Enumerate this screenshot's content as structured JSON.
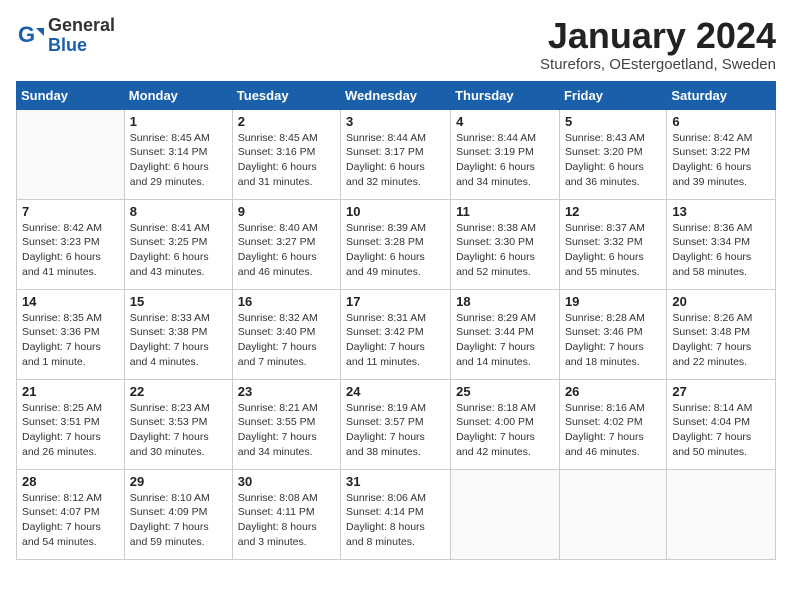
{
  "header": {
    "logo_general": "General",
    "logo_blue": "Blue",
    "title": "January 2024",
    "subtitle": "Sturefors, OEstergoetland, Sweden"
  },
  "days_of_week": [
    "Sunday",
    "Monday",
    "Tuesday",
    "Wednesday",
    "Thursday",
    "Friday",
    "Saturday"
  ],
  "weeks": [
    [
      {
        "day": "",
        "detail": ""
      },
      {
        "day": "1",
        "detail": "Sunrise: 8:45 AM\nSunset: 3:14 PM\nDaylight: 6 hours\nand 29 minutes."
      },
      {
        "day": "2",
        "detail": "Sunrise: 8:45 AM\nSunset: 3:16 PM\nDaylight: 6 hours\nand 31 minutes."
      },
      {
        "day": "3",
        "detail": "Sunrise: 8:44 AM\nSunset: 3:17 PM\nDaylight: 6 hours\nand 32 minutes."
      },
      {
        "day": "4",
        "detail": "Sunrise: 8:44 AM\nSunset: 3:19 PM\nDaylight: 6 hours\nand 34 minutes."
      },
      {
        "day": "5",
        "detail": "Sunrise: 8:43 AM\nSunset: 3:20 PM\nDaylight: 6 hours\nand 36 minutes."
      },
      {
        "day": "6",
        "detail": "Sunrise: 8:42 AM\nSunset: 3:22 PM\nDaylight: 6 hours\nand 39 minutes."
      }
    ],
    [
      {
        "day": "7",
        "detail": "Sunrise: 8:42 AM\nSunset: 3:23 PM\nDaylight: 6 hours\nand 41 minutes."
      },
      {
        "day": "8",
        "detail": "Sunrise: 8:41 AM\nSunset: 3:25 PM\nDaylight: 6 hours\nand 43 minutes."
      },
      {
        "day": "9",
        "detail": "Sunrise: 8:40 AM\nSunset: 3:27 PM\nDaylight: 6 hours\nand 46 minutes."
      },
      {
        "day": "10",
        "detail": "Sunrise: 8:39 AM\nSunset: 3:28 PM\nDaylight: 6 hours\nand 49 minutes."
      },
      {
        "day": "11",
        "detail": "Sunrise: 8:38 AM\nSunset: 3:30 PM\nDaylight: 6 hours\nand 52 minutes."
      },
      {
        "day": "12",
        "detail": "Sunrise: 8:37 AM\nSunset: 3:32 PM\nDaylight: 6 hours\nand 55 minutes."
      },
      {
        "day": "13",
        "detail": "Sunrise: 8:36 AM\nSunset: 3:34 PM\nDaylight: 6 hours\nand 58 minutes."
      }
    ],
    [
      {
        "day": "14",
        "detail": "Sunrise: 8:35 AM\nSunset: 3:36 PM\nDaylight: 7 hours\nand 1 minute."
      },
      {
        "day": "15",
        "detail": "Sunrise: 8:33 AM\nSunset: 3:38 PM\nDaylight: 7 hours\nand 4 minutes."
      },
      {
        "day": "16",
        "detail": "Sunrise: 8:32 AM\nSunset: 3:40 PM\nDaylight: 7 hours\nand 7 minutes."
      },
      {
        "day": "17",
        "detail": "Sunrise: 8:31 AM\nSunset: 3:42 PM\nDaylight: 7 hours\nand 11 minutes."
      },
      {
        "day": "18",
        "detail": "Sunrise: 8:29 AM\nSunset: 3:44 PM\nDaylight: 7 hours\nand 14 minutes."
      },
      {
        "day": "19",
        "detail": "Sunrise: 8:28 AM\nSunset: 3:46 PM\nDaylight: 7 hours\nand 18 minutes."
      },
      {
        "day": "20",
        "detail": "Sunrise: 8:26 AM\nSunset: 3:48 PM\nDaylight: 7 hours\nand 22 minutes."
      }
    ],
    [
      {
        "day": "21",
        "detail": "Sunrise: 8:25 AM\nSunset: 3:51 PM\nDaylight: 7 hours\nand 26 minutes."
      },
      {
        "day": "22",
        "detail": "Sunrise: 8:23 AM\nSunset: 3:53 PM\nDaylight: 7 hours\nand 30 minutes."
      },
      {
        "day": "23",
        "detail": "Sunrise: 8:21 AM\nSunset: 3:55 PM\nDaylight: 7 hours\nand 34 minutes."
      },
      {
        "day": "24",
        "detail": "Sunrise: 8:19 AM\nSunset: 3:57 PM\nDaylight: 7 hours\nand 38 minutes."
      },
      {
        "day": "25",
        "detail": "Sunrise: 8:18 AM\nSunset: 4:00 PM\nDaylight: 7 hours\nand 42 minutes."
      },
      {
        "day": "26",
        "detail": "Sunrise: 8:16 AM\nSunset: 4:02 PM\nDaylight: 7 hours\nand 46 minutes."
      },
      {
        "day": "27",
        "detail": "Sunrise: 8:14 AM\nSunset: 4:04 PM\nDaylight: 7 hours\nand 50 minutes."
      }
    ],
    [
      {
        "day": "28",
        "detail": "Sunrise: 8:12 AM\nSunset: 4:07 PM\nDaylight: 7 hours\nand 54 minutes."
      },
      {
        "day": "29",
        "detail": "Sunrise: 8:10 AM\nSunset: 4:09 PM\nDaylight: 7 hours\nand 59 minutes."
      },
      {
        "day": "30",
        "detail": "Sunrise: 8:08 AM\nSunset: 4:11 PM\nDaylight: 8 hours\nand 3 minutes."
      },
      {
        "day": "31",
        "detail": "Sunrise: 8:06 AM\nSunset: 4:14 PM\nDaylight: 8 hours\nand 8 minutes."
      },
      {
        "day": "",
        "detail": ""
      },
      {
        "day": "",
        "detail": ""
      },
      {
        "day": "",
        "detail": ""
      }
    ]
  ]
}
